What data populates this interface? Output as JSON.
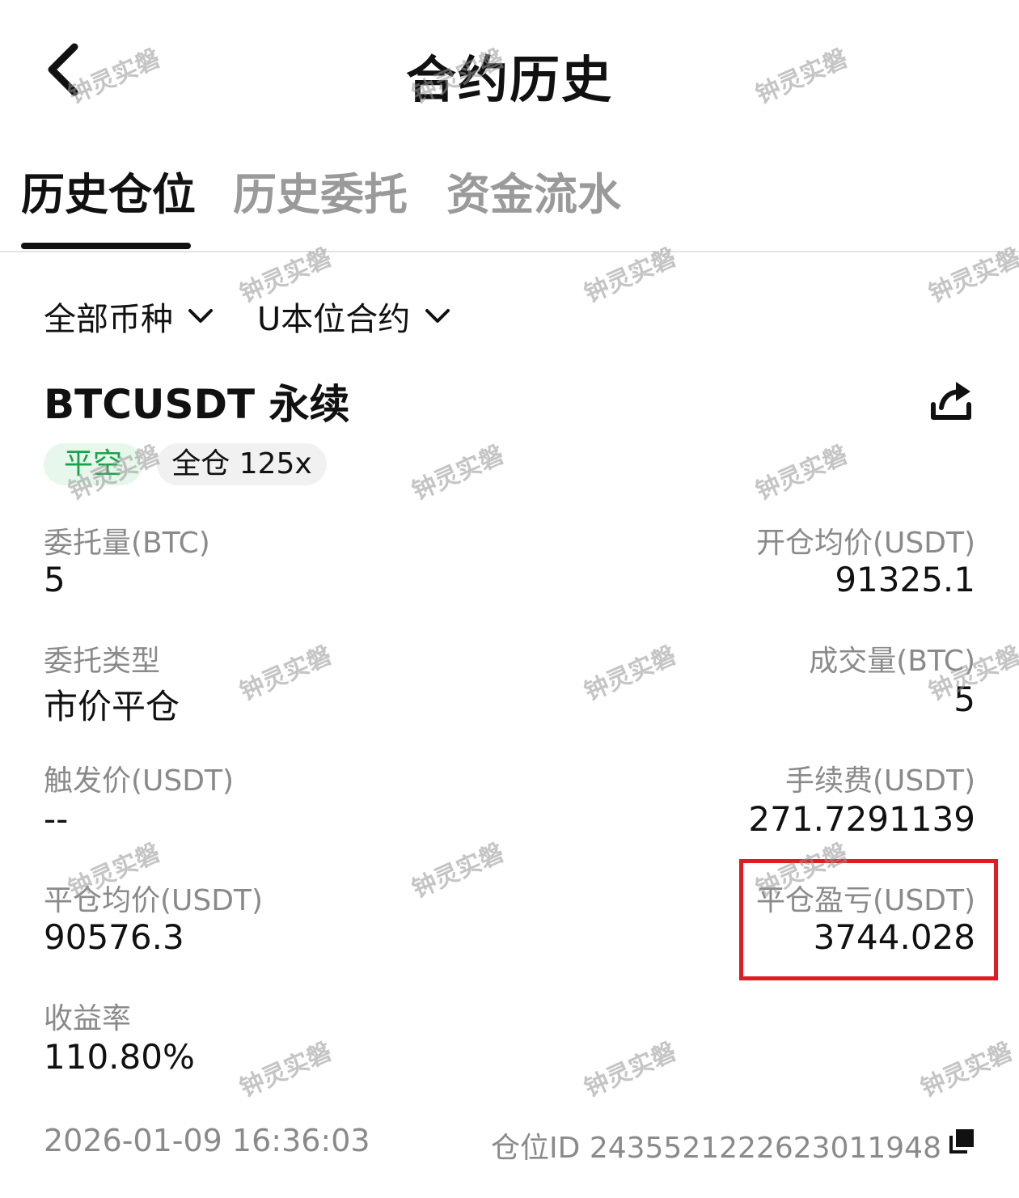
{
  "header": {
    "title": "合约历史"
  },
  "tabs": [
    {
      "label": "历史仓位"
    },
    {
      "label": "历史委托"
    },
    {
      "label": "资金流水"
    }
  ],
  "filters": {
    "coin": "全部币种",
    "contract_type": "U本位合约"
  },
  "position": {
    "symbol": "BTCUSDT 永续",
    "side_badge": "平空",
    "margin_badge": "全仓 125x",
    "fields": {
      "order_qty_label": "委托量(BTC)",
      "order_qty_value": "5",
      "open_avg_label": "开仓均价(USDT)",
      "open_avg_value": "91325.1",
      "order_type_label": "委托类型",
      "order_type_value": "市价平仓",
      "filled_qty_label": "成交量(BTC)",
      "filled_qty_value": "5",
      "trigger_label": "触发价(USDT)",
      "trigger_value": "--",
      "fee_label": "手续费(USDT)",
      "fee_value": "271.7291139",
      "close_avg_label": "平仓均价(USDT)",
      "close_avg_value": "90576.3",
      "pnl_label": "平仓盈亏(USDT)",
      "pnl_value": "3744.028",
      "roi_label": "收益率",
      "roi_value": "110.80%"
    },
    "timestamp": "2026-01-09 16:36:03",
    "position_id": "仓位ID 2435521222623011948"
  },
  "watermark": "钟灵实磐",
  "colors": {
    "accent_green": "#17a34a",
    "highlight_red": "#e01b24",
    "muted_text": "#8a8a8a"
  },
  "icons": [
    "back-arrow-icon",
    "chevron-down-icon",
    "share-icon",
    "copy-icon"
  ]
}
